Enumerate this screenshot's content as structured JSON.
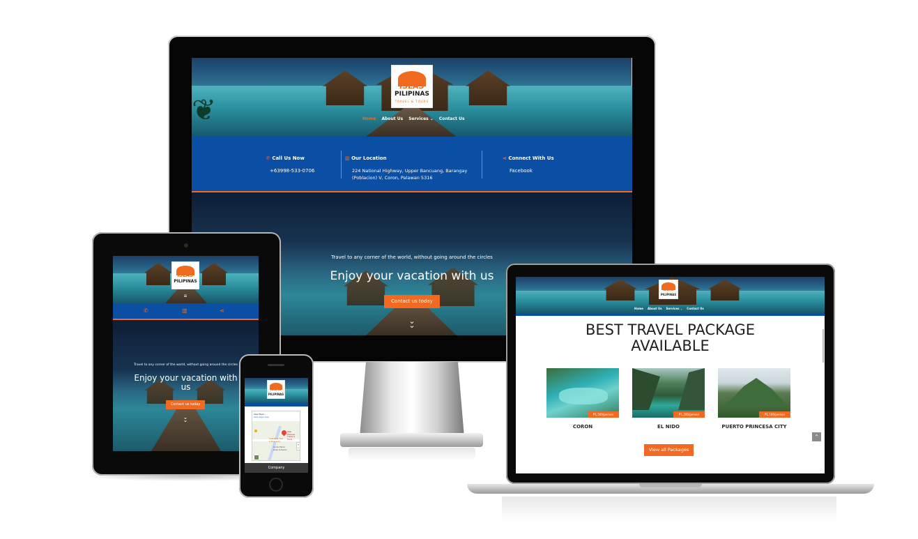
{
  "brand": {
    "logo_line1": "ISLAS",
    "logo_line2": "PILIPINAS",
    "logo_line3": "TRAVEL & TOURS"
  },
  "nav": {
    "home": "Home",
    "about": "About Us",
    "services": "Services",
    "contact": "Contact Us"
  },
  "info_bar": {
    "call_title": "Call Us Now",
    "call_value": "+63998-533-0706",
    "location_title": "Our Location",
    "location_line1": "224 National Highway, Upper Bancuang, Barangay",
    "location_line2": "(Poblacion) V, Coron, Palawan 5316",
    "connect_title": "Connect With Us",
    "connect_value": "Facebook"
  },
  "hero": {
    "tagline": "Travel to any corner of the world, without going around the circles",
    "headline": "Enjoy your vacation with us",
    "tablet_headline_line1": "Enjoy your vacation with",
    "tablet_headline_line2": "us",
    "cta": "Contact us today",
    "scroll_icon": "double-chevron-down-icon"
  },
  "packages": {
    "heading_line1": "BEST TRAVEL PACKAGE",
    "heading_line2": "AVAILABLE",
    "items": [
      {
        "name": "CORON",
        "price": "₱1,500/person"
      },
      {
        "name": "EL NIDO",
        "price": "₱1,200/person"
      },
      {
        "name": "PUERTO PRINCESA CITY",
        "price": "₱1,100/person"
      }
    ],
    "view_all": "View all Packages"
  },
  "phone": {
    "map_place_line1": "Islas Pilipin...",
    "map_place_line2": "View larger map",
    "map_pin_label_line1": "Islas Pilipinas",
    "map_pin_label_line2": "Travel & Tours",
    "map_poi_label_line1": "Ugallatsar Taal",
    "map_poi_label_line2": "& Boat Corp",
    "map_poi2_label_line1": "Coron Plaza",
    "map_poi2_label_line2": "Hotel & Resort",
    "footer_label": "Company"
  },
  "colors": {
    "accent_orange": "#f26a21",
    "info_blue": "#0a4fa3",
    "laptop_blue": "#0a4fa3"
  }
}
